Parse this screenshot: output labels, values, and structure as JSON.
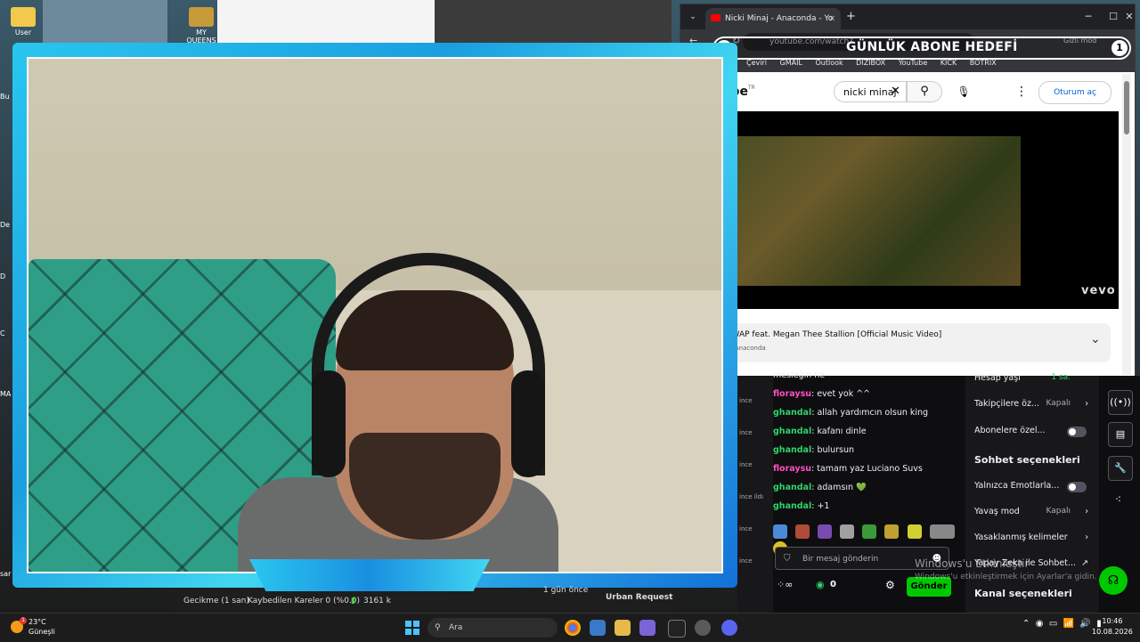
{
  "desktop": {
    "icons": [
      {
        "label": "User"
      },
      {
        "label": "MY QUEENS"
      }
    ],
    "left_labels": [
      "Bu",
      "De",
      "D",
      "C",
      "MA",
      "sar"
    ]
  },
  "webcam": {
    "overlay_label": "Webcam overlay"
  },
  "goal": {
    "left_num": "0",
    "label": "GÜNLÜK ABONE HEDEFİ",
    "right_num": "1"
  },
  "browser": {
    "tab_title": "Nicki Minaj - Anaconda - Yo",
    "tab_close": "×",
    "new_tab": "+",
    "minimize": "─",
    "maximize": "☐",
    "close": "✕",
    "url": "youtube.com/watch?v=LDZX4ooRsWs&list=RDLDZ",
    "profile": "Gizli mod",
    "bookmarks": [
      "Çeviri",
      "GMAIL",
      "Outlook",
      "DIZIBOX",
      "YouTube",
      "KICK",
      "BOTRIX"
    ]
  },
  "youtube": {
    "logo": "YouTube",
    "country": "TR",
    "search_value": "nicki minaj",
    "sign_in": "Oturum aç",
    "vevo": "vevo",
    "next_title": "Cardi B - WAP feat. Megan Thee Stallion [Official Music Video]",
    "next_sub": "Nicki Minaj - Anaconda"
  },
  "chat": {
    "messages": [
      {
        "user": "",
        "text": "mesleğin ne",
        "color": "#efeff1"
      },
      {
        "user": "floraysu",
        "text": ": evet yok ^^",
        "color": "#ff4ec3"
      },
      {
        "user": "ghandal",
        "text": ": allah yardımcın olsun king",
        "color": "#2fd36b"
      },
      {
        "user": "ghandal",
        "text": ": kafanı dinle",
        "color": "#2fd36b"
      },
      {
        "user": "ghandal",
        "text": ": bulursun",
        "color": "#2fd36b"
      },
      {
        "user": "floraysu",
        "text": ": tamam yaz Luciano Suvs",
        "color": "#ff4ec3"
      },
      {
        "user": "ghandal",
        "text": ": adamsın 💚",
        "color": "#2fd36b"
      },
      {
        "user": "ghandal",
        "text": ": +1",
        "color": "#2fd36b"
      }
    ],
    "input_placeholder": "Bir mesaj gönderin",
    "points": "0",
    "send": "Gönder",
    "left_strip": [
      "ince",
      "ince",
      "ince",
      "ince ildı",
      "ince",
      "ince",
      "ince",
      "ince"
    ]
  },
  "settings": {
    "rows": [
      {
        "label": "Hesap yaşı",
        "value": "1 sa."
      },
      {
        "label": "Takipçilere öz...",
        "value": "Kapalı"
      },
      {
        "label": "Abonelere özel...",
        "value": ""
      }
    ],
    "chat_options_title": "Sohbet seçenekleri",
    "chat_rows": [
      {
        "label": "Yalnızca Emotlarla...",
        "value": ""
      },
      {
        "label": "Yavaş mod",
        "value": "Kapalı"
      },
      {
        "label": "Yasaklanmış kelimeler",
        "value": ""
      },
      {
        "label": "Yapay Zeka ile Sohbet...",
        "value": ""
      }
    ],
    "channel_options_title": "Kanal seçenekleri"
  },
  "watermark": {
    "line1": "Windows'u Etkinleştir",
    "line2": "Windows'u etkinleştirmek için Ayarlar'a gidin."
  },
  "status": {
    "delay": "Gecikme (1 san)",
    "dropped": "Kaybedilen Kareler 0 (%0.0)",
    "bitrate": "3161 k",
    "ago": "1 gün önce",
    "next": "Urban Request"
  },
  "taskbar": {
    "temp": "23°C",
    "weather": "Güneşli",
    "badge": "1",
    "search": "Ara",
    "time": "10:46",
    "date": "10.08.2026"
  }
}
